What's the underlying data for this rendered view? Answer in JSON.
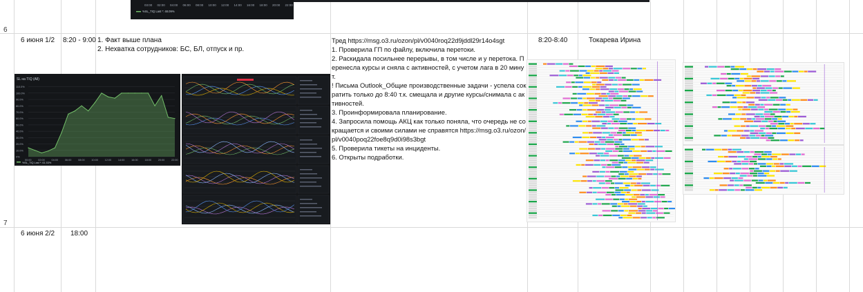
{
  "rows": [
    {
      "num": "6"
    },
    {
      "num": "7"
    }
  ],
  "row_a": {
    "date": "6 июня 1/2",
    "time": "8:20 - 9:00",
    "issues": [
      "1. Факт выше плана",
      "2. Нехватка сотрудников: БС, БЛ, отпуск и пр."
    ],
    "actions": [
      "Тред https://msg.o3.ru/ozon/pl/v0040roq22d9jddl29r14o4sgt",
      "1. Проверила ГП по файлу, включила перетоки.",
      "2. Раскидала посильнее перерывы, в том числе и у перетока. Перенесла курсы и сняла с активностей, с учетом лага в 20 минут.",
      "! Письма Outlook_Общие производственные задачи - успела сократить только до 8:40 т.к. смещала и другие курсы/снимала с активностей.",
      "3. Проинформировала планирование.",
      "4. Запросила помощь АКЦ как только поняла, что очередь не сокращается и своими силами не справятся https://msg.o3.ru/ozon/pl/v0040poq22foe8q9d0i98s3bgt",
      "5. Проверила тикеты на инциденты.",
      "6. Открыты подработки."
    ],
    "time2": "8:20-8:40",
    "person": "Токарева Ирина"
  },
  "row_b": {
    "date": "6 июня 2/2",
    "time": "18:00"
  },
  "top_chart": {
    "xticks": [
      "03:00",
      "02:00",
      "04:00",
      "06:00",
      "08:00",
      "10:00",
      "12:00",
      "14:00",
      "16:00",
      "18:00",
      "20:00",
      "22:00"
    ],
    "legend": "%SL_TIQ  Last *: 48.09%",
    "series_color": "#73bf69"
  },
  "chart_data": {
    "type": "area",
    "title": "SL на TIQ (All)",
    "xlabel": "",
    "ylabel": "",
    "x": [
      "00:00",
      "01:00",
      "02:00",
      "03:00",
      "04:00",
      "05:00",
      "06:00",
      "07:00",
      "08:00",
      "09:00",
      "10:00",
      "11:00",
      "12:00",
      "13:00",
      "14:00",
      "15:00",
      "16:00",
      "17:00",
      "18:00",
      "19:00",
      "20:00",
      "21:00",
      "22:00"
    ],
    "yticks": [
      "0%",
      "10.0%",
      "20.0%",
      "30.0%",
      "40.0%",
      "50.0%",
      "60.0%",
      "70.0%",
      "80.0%",
      "90.0%",
      "100.0%",
      "110.0%"
    ],
    "xticks": [
      "00:00",
      "02:00",
      "04:00",
      "06:00",
      "08:00",
      "10:00",
      "12:00",
      "14:00",
      "16:00",
      "18:00",
      "20:00",
      "22:00"
    ],
    "series": [
      {
        "name": "%SL_TIQ",
        "values": [
          14,
          10,
          6,
          9,
          14,
          38,
          67,
          72,
          80,
          72,
          85,
          100,
          94,
          92,
          100,
          100,
          100,
          100,
          100,
          80,
          96,
          62,
          60
        ]
      }
    ],
    "ylim": [
      0,
      115
    ],
    "legend_text": "%SL_TIQ  Last *: 61.53%",
    "color": "#73bf69"
  },
  "colors": {
    "grid": "#d9d9d9",
    "dark_panel": "#141619"
  }
}
